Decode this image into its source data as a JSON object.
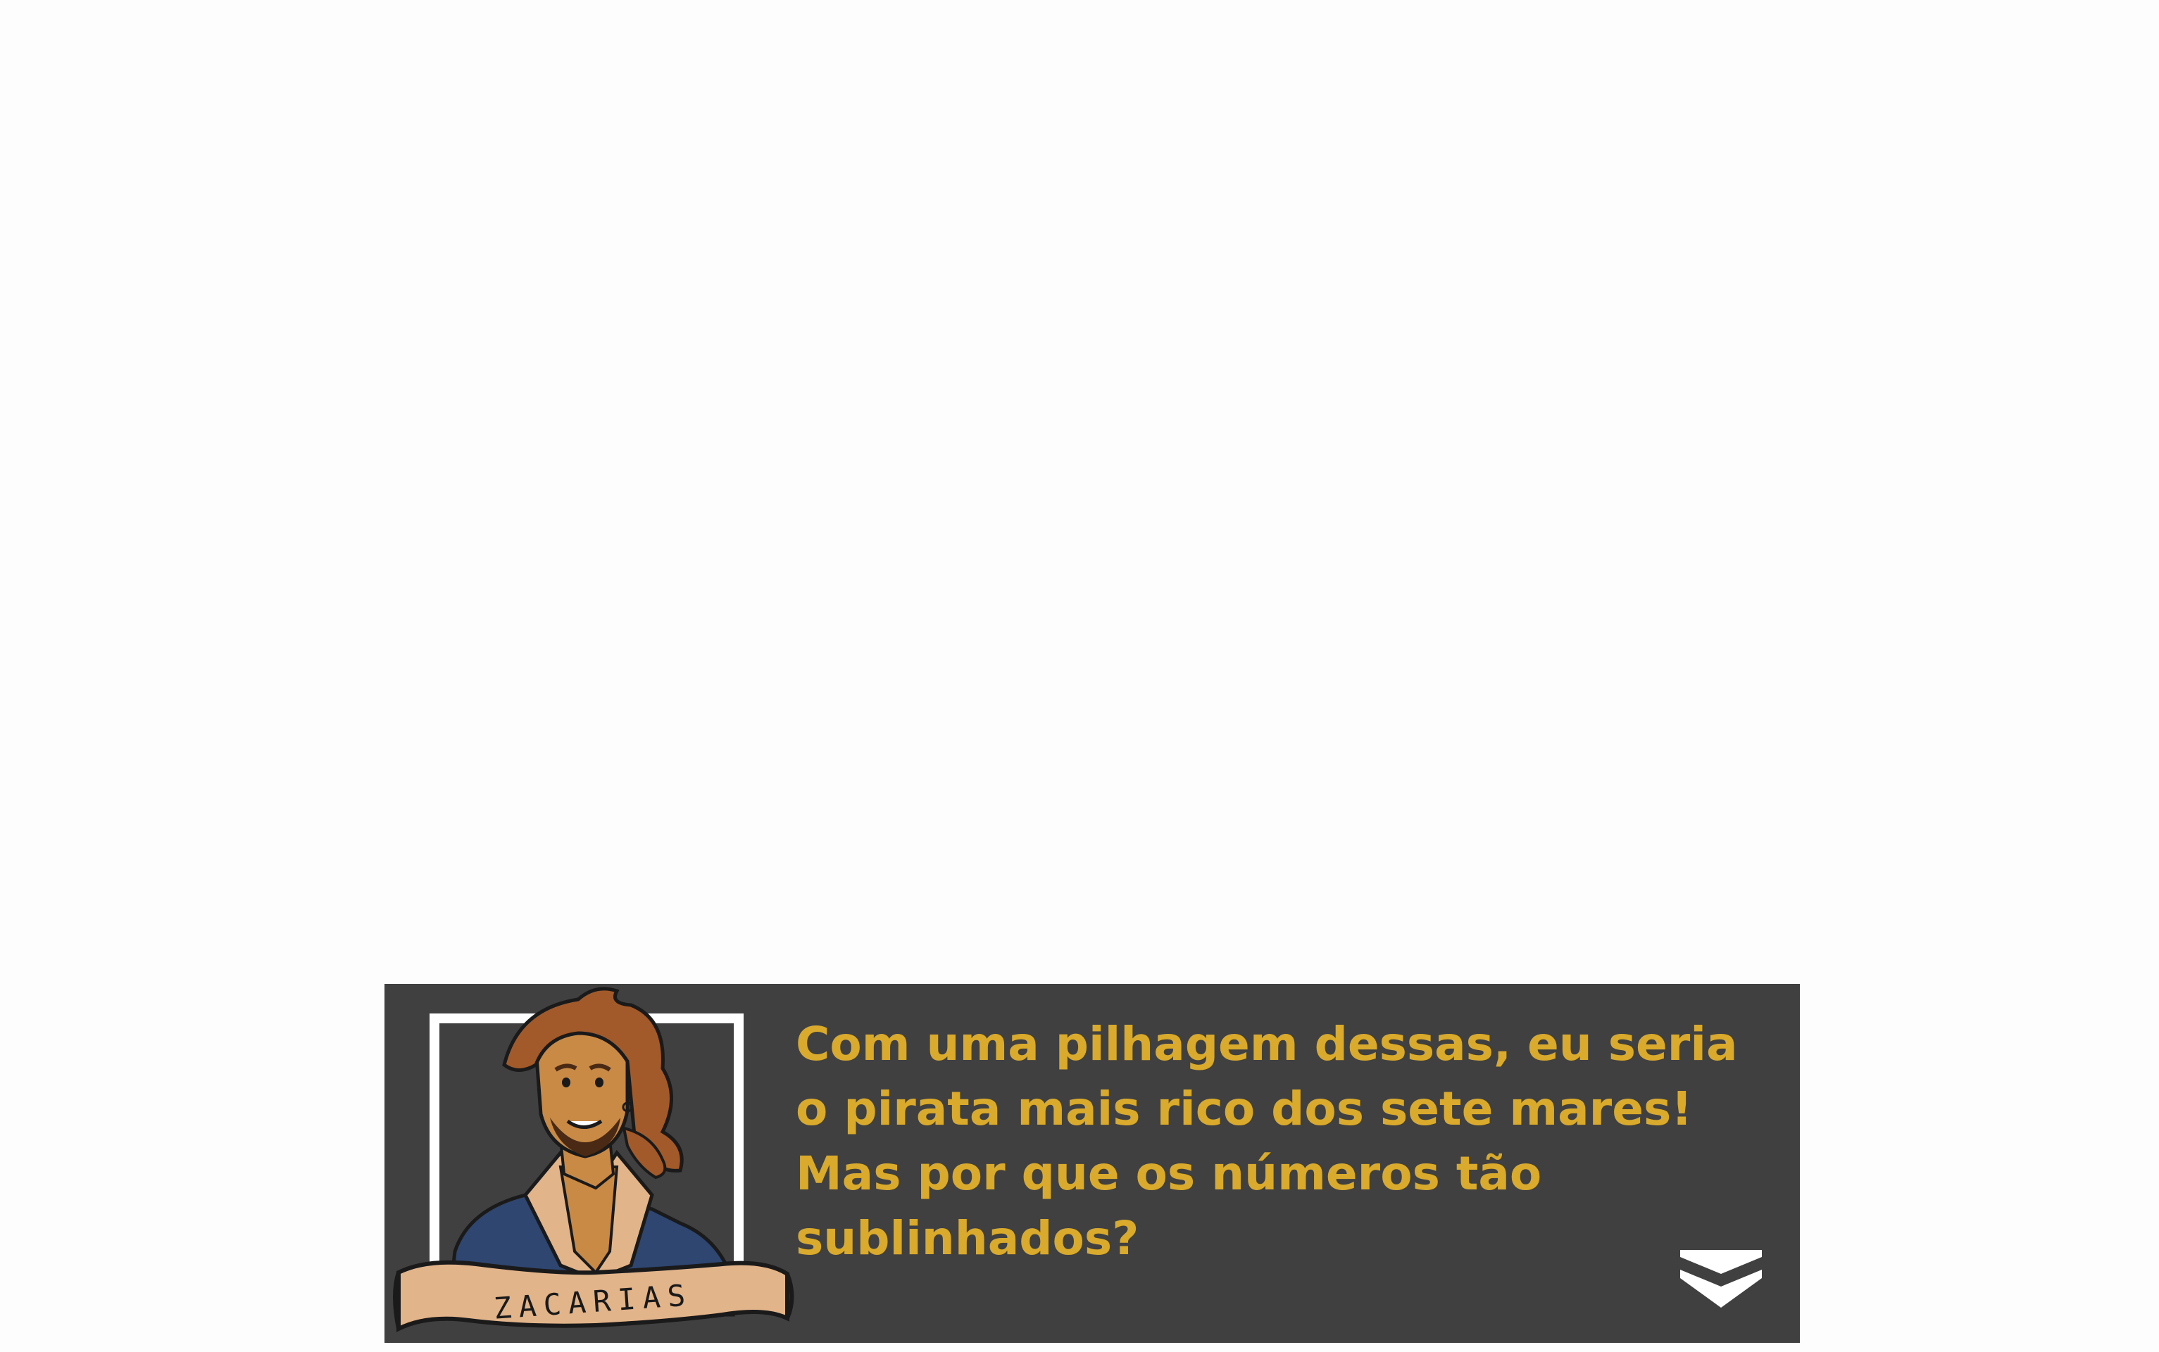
{
  "dialog": {
    "speaker_name": "ZACARIAS",
    "lines": [
      "Com uma pilhagem dessas, eu seria",
      "o pirata mais rico dos sete mares!",
      "Mas por que os números tão",
      "sublinhados?"
    ],
    "text_color": "#d9aa2b",
    "box_color": "#404040"
  },
  "icons": {
    "continue": "double-chevron-down-icon"
  }
}
